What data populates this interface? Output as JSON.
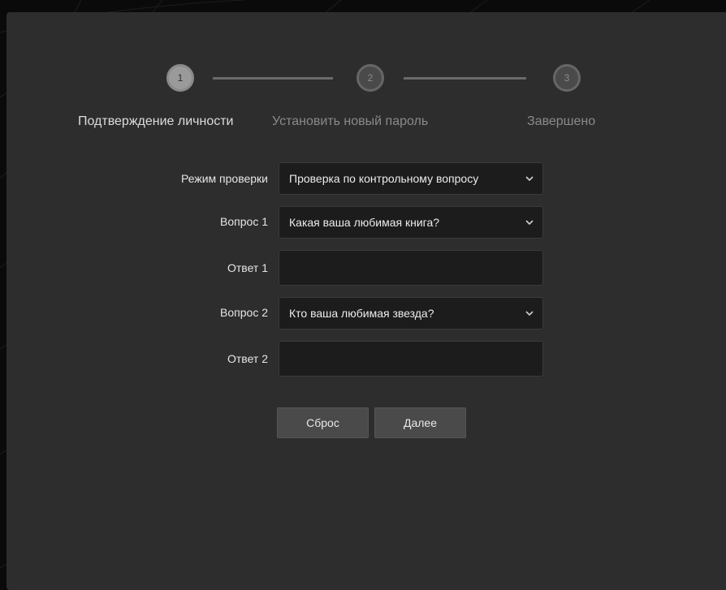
{
  "stepper": {
    "steps": [
      {
        "number": "1",
        "label": "Подтверждение личности",
        "state": "active"
      },
      {
        "number": "2",
        "label": "Установить новый пароль",
        "state": "inactive"
      },
      {
        "number": "3",
        "label": "Завершено",
        "state": "inactive"
      }
    ]
  },
  "form": {
    "verify_mode": {
      "label": "Режим проверки",
      "value": "Проверка по контрольному вопросу"
    },
    "question1": {
      "label": "Вопрос 1",
      "value": "Какая ваша любимая книга?"
    },
    "answer1": {
      "label": "Ответ 1",
      "value": ""
    },
    "question2": {
      "label": "Вопрос 2",
      "value": "Кто ваша любимая звезда?"
    },
    "answer2": {
      "label": "Ответ 2",
      "value": ""
    }
  },
  "buttons": {
    "reset_label": "Сброс",
    "next_label": "Далее"
  },
  "colors": {
    "panel": "#2d2d2d",
    "field_background": "#1c1c1c",
    "button": "#4a4a4a"
  }
}
